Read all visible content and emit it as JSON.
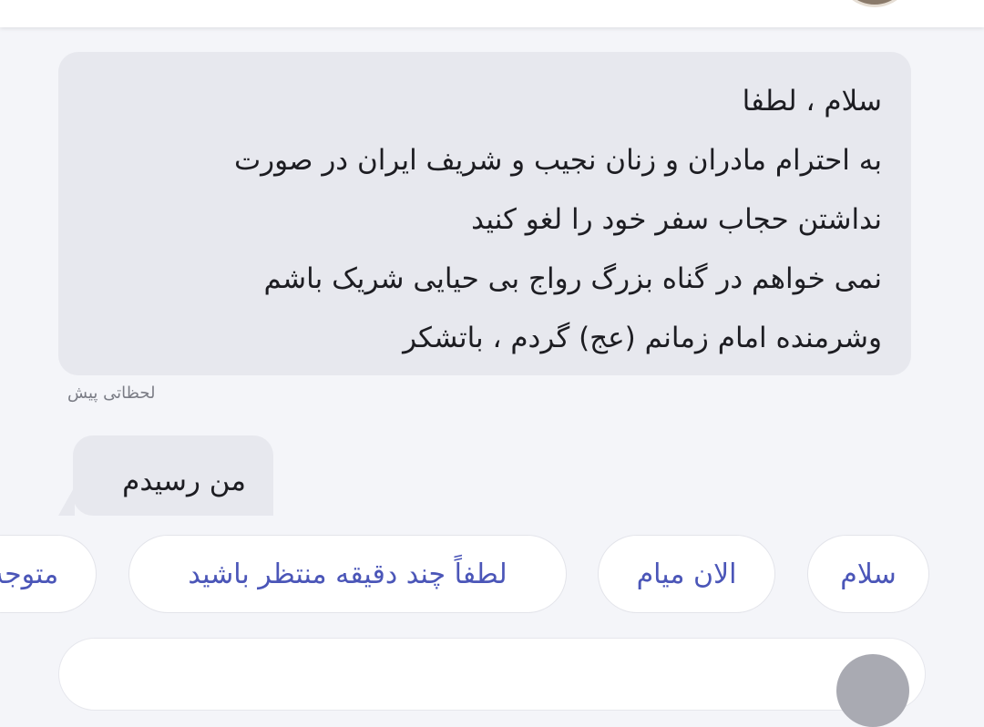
{
  "message_received": {
    "lines": [
      "سلام ، لطفا",
      "به احترام مادران و زنان  نجیب و شریف ایران در صورت",
      "نداشتن حجاب سفر خود را لغو کنید",
      "نمی خواهم در گناه بزرگ رواج بی حیایی شریک باشم",
      "وشرمنده امام زمانم (عج) گردم ، باتشکر"
    ],
    "timestamp": "لحظاتی پیش"
  },
  "message_sent": {
    "text": "من رسیدم"
  },
  "quick_replies": [
    "سلام",
    "الان میام",
    "لطفاً چند دقیقه منتظر باشید",
    "متوجه"
  ],
  "colors": {
    "background": "#f4f5f9",
    "bubble": "#e7e8ee",
    "chip_text": "#4b56b8",
    "timestamp": "#7b7d86"
  }
}
